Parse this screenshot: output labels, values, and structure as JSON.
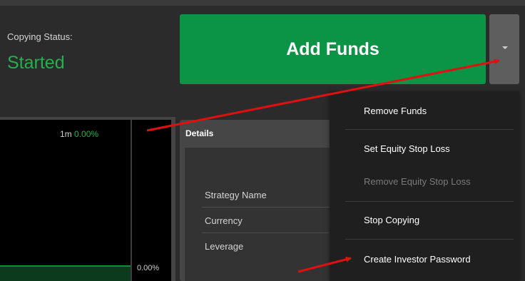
{
  "status": {
    "label": "Copying Status:",
    "value": "Started"
  },
  "actions": {
    "add_funds_label": "Add Funds"
  },
  "chart": {
    "period_label": "1m",
    "period_return": "0.00%",
    "axis_value": "0.00%"
  },
  "details": {
    "title": "Details",
    "rows": [
      {
        "label": "Strategy Name"
      },
      {
        "label": "Currency"
      },
      {
        "label": "Leverage"
      }
    ]
  },
  "menu": {
    "items": [
      {
        "label": "Remove Funds",
        "enabled": true
      },
      {
        "label": "Set Equity Stop Loss",
        "enabled": true
      },
      {
        "label": "Remove Equity Stop Loss",
        "enabled": false
      },
      {
        "label": "Stop Copying",
        "enabled": true
      },
      {
        "label": "Create Investor Password",
        "enabled": true
      }
    ]
  },
  "colors": {
    "accent_green": "#0b9445",
    "status_green": "#22b14c",
    "annotation_red": "#e01010"
  },
  "icons": {
    "dropdown_toggle": "caret-down-icon"
  }
}
